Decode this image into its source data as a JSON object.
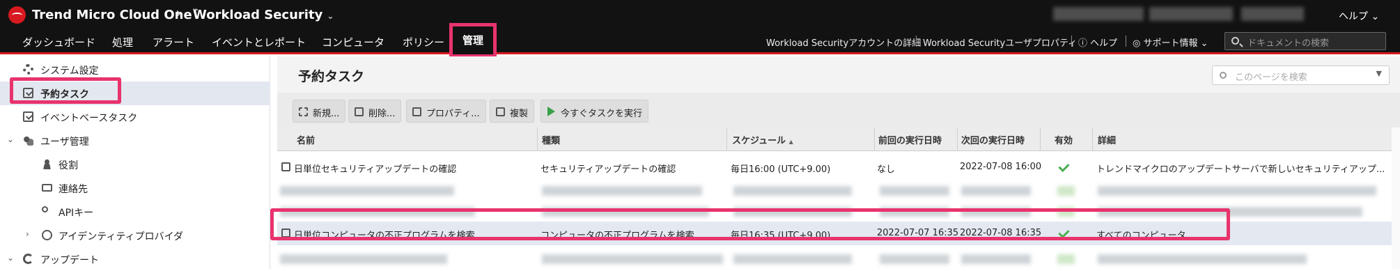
{
  "topbar": {
    "brand": "Trend Micro Cloud One",
    "brand_tm": "™",
    "crumb_sep": "›",
    "product": "Workload Security",
    "product_chevron": "⌄",
    "help": "ヘルプ ⌄"
  },
  "nav": {
    "items": [
      "ダッシュボード",
      "処理",
      "アラート",
      "イベントとレポート",
      "コンピュータ",
      "ポリシー",
      "管理"
    ],
    "active_index": 6,
    "utils": {
      "account": "Workload Securityアカウントの詳細",
      "user_props": "Workload Securityユーザプロパティ",
      "help": "ヘルプ",
      "support": "サポート情報 ⌄"
    },
    "search_placeholder": "ドキュメントの検索"
  },
  "sidebar": {
    "items": [
      {
        "label": "システム設定",
        "icon": "gear-icon"
      },
      {
        "label": "予約タスク",
        "icon": "scheduled-task-icon",
        "selected": true
      },
      {
        "label": "イベントベースタスク",
        "icon": "task-icon"
      },
      {
        "label": "ユーザ管理",
        "icon": "users-icon",
        "expanded": true
      },
      {
        "label": "役割",
        "icon": "role-icon"
      },
      {
        "label": "連絡先",
        "icon": "contact-card-icon"
      },
      {
        "label": "APIキー",
        "icon": "key-icon"
      },
      {
        "label": "アイデンティティプロバイダ",
        "icon": "globe-icon"
      },
      {
        "label": "アップデート",
        "icon": "update-icon"
      }
    ]
  },
  "main": {
    "title": "予約タスク",
    "search_placeholder": "このページを検索",
    "toolbar": {
      "new": "新規...",
      "delete": "削除...",
      "properties": "プロパティ...",
      "duplicate": "複製",
      "run_now": "今すぐタスクを実行"
    },
    "columns": [
      "名前",
      "種類",
      "スケジュール",
      "前回の実行日時",
      "次回の実行日時",
      "有効",
      "詳細"
    ],
    "sort_indicator": "▲",
    "rows": [
      {
        "name": "日単位セキュリティアップデートの確認",
        "type": "セキュリティアップデートの確認",
        "schedule": "毎日16:00 (UTC+9.00)",
        "last_run": "なし",
        "next_run": "2022-07-08 16:00",
        "enabled": true,
        "details": "トレンドマイクロのアップデートサーバで新しいセキュリティアップ..."
      },
      {
        "name": "日単位コンピュータの不正プログラムを検索",
        "type": "コンピュータの不正プログラムを検索",
        "schedule": "毎日16:35 (UTC+9.00)",
        "last_run": "2022-07-07 16:35",
        "next_run": "2022-07-08 16:35",
        "enabled": true,
        "details": "すべてのコンピュータ",
        "selected": true
      }
    ]
  },
  "colors": {
    "topbar_bg": "#121212",
    "brand_red": "#d71920",
    "highlight_pink": "#e8336d",
    "selection_bg": "#e3e8f1",
    "enabled_green": "#4caf50"
  }
}
